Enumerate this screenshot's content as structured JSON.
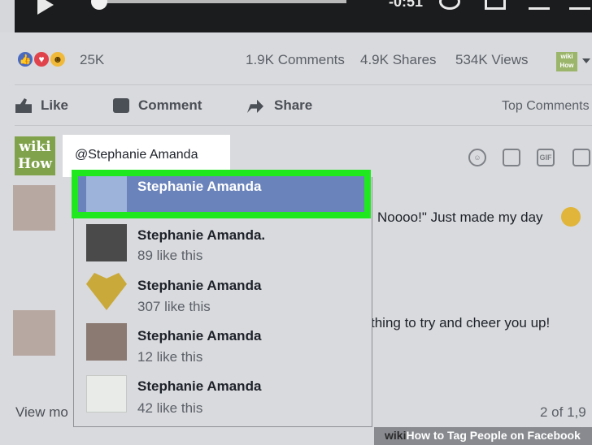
{
  "video": {
    "time": "-0:51"
  },
  "post_stats": {
    "reactions_count": "25K",
    "comments": "1.9K Comments",
    "shares": "4.9K Shares",
    "views": "534K Views"
  },
  "actions": {
    "like": "Like",
    "comment": "Comment",
    "share": "Share",
    "top_comments": "Top Comments"
  },
  "composer": {
    "avatar_line1": "wiki",
    "avatar_line2": "How",
    "input_value": "@Stephanie Amanda",
    "icons": [
      "smiley-icon",
      "camera-icon",
      "gif-icon",
      "sticker-icon"
    ],
    "gif_label": "GIF"
  },
  "background_comments": {
    "c1_text": "Noooo!\" Just made my day",
    "c2_text": "thing to try and cheer you up!",
    "view_more": "View mo",
    "page_count": "2 of 1,9"
  },
  "mention_suggestions": [
    {
      "name": "Stephanie Amanda",
      "likes": ""
    },
    {
      "name": "Stephanie Amanda.",
      "likes": "89 like this"
    },
    {
      "name": "Stephanie Amanda",
      "likes": "307 like this"
    },
    {
      "name": "Stephanie Amanda",
      "likes": "12 like this"
    },
    {
      "name": "Stephanie Amanda",
      "likes": "42 like this"
    }
  ],
  "footer": {
    "brand_wiki": "wiki",
    "title": "How to Tag People on Facebook"
  },
  "colors": {
    "highlight_green": "#1fe81f",
    "selected_row": "#6a83bb"
  }
}
